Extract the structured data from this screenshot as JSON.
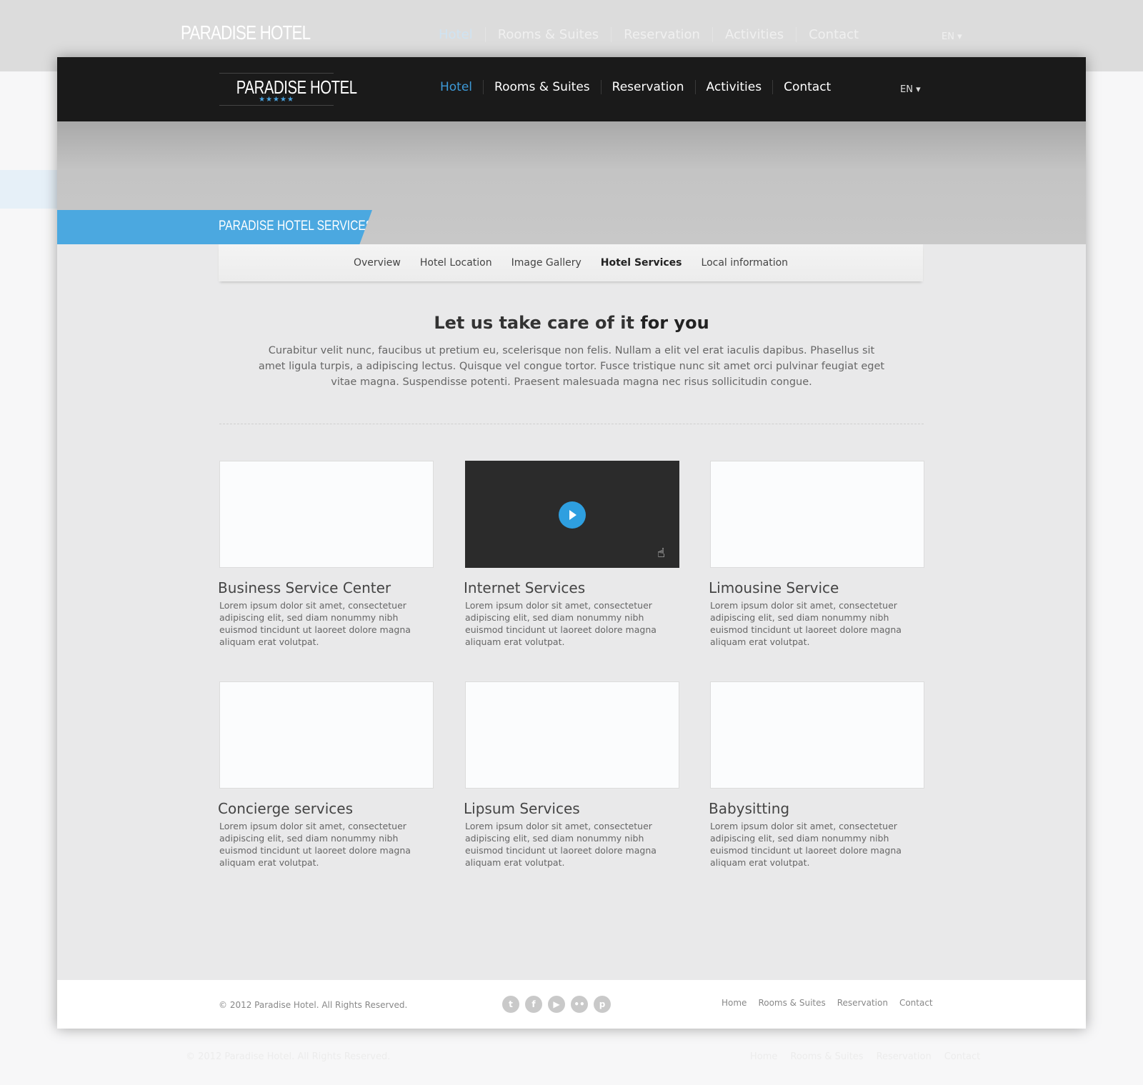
{
  "brand": {
    "name": "PARADISE HOTEL",
    "stars": "★★★★★"
  },
  "nav": {
    "items": [
      "Hotel",
      "Rooms & Suites",
      "Reservation",
      "Activities",
      "Contact"
    ],
    "active": "Hotel",
    "lang": "EN ▾"
  },
  "banner": {
    "title": "PARADISE HOTEL SERVICES"
  },
  "subnav": {
    "items": [
      "Overview",
      "Hotel Location",
      "Image Gallery",
      "Hotel Services",
      "Local information"
    ],
    "active": "Hotel Services"
  },
  "intro": {
    "title_plain": "Let us take care of it ",
    "title_bold": "for you",
    "text": "Curabitur velit nunc, faucibus ut pretium eu, scelerisque non felis. Nullam a elit vel erat iaculis dapibus. Phasellus sit amet ligula turpis, a adipiscing lectus. Quisque vel congue tortor. Fusce tristique nunc sit amet orci pulvinar feugiat eget vitae magna. Suspendisse potenti. Praesent malesuada magna nec risus sollicitudin congue."
  },
  "services": [
    {
      "title": "Business Service Center",
      "text": "Lorem ipsum dolor sit amet, consectetuer adipiscing elit, sed diam nonummy nibh euismod tincidunt ut laoreet dolore magna aliquam erat volutpat."
    },
    {
      "title": "Internet Services",
      "text": "Lorem ipsum dolor sit amet, consectetuer adipiscing elit, sed diam nonummy nibh euismod tincidunt ut laoreet dolore magna aliquam erat volutpat.",
      "video": true
    },
    {
      "title": "Limousine Service",
      "text": "Lorem ipsum dolor sit amet, consectetuer adipiscing elit, sed diam nonummy nibh euismod tincidunt ut laoreet dolore magna aliquam erat volutpat."
    },
    {
      "title": "Concierge services",
      "text": "Lorem ipsum dolor sit amet, consectetuer adipiscing elit, sed diam nonummy nibh euismod tincidunt ut laoreet dolore magna aliquam erat volutpat."
    },
    {
      "title": "Lipsum Services",
      "text": "Lorem ipsum dolor sit amet, consectetuer adipiscing elit, sed diam nonummy nibh euismod tincidunt ut laoreet dolore magna aliquam erat volutpat."
    },
    {
      "title": "Babysitting",
      "text": "Lorem ipsum dolor sit amet, consectetuer adipiscing elit, sed diam nonummy nibh euismod tincidunt ut laoreet dolore magna aliquam erat volutpat."
    }
  ],
  "footer": {
    "copyright": "© 2012 Paradise Hotel. All Rights Reserved.",
    "social": [
      {
        "name": "twitter-icon",
        "glyph": "t"
      },
      {
        "name": "facebook-icon",
        "glyph": "f"
      },
      {
        "name": "youtube-icon",
        "glyph": "▶"
      },
      {
        "name": "flickr-icon",
        "glyph": "••"
      },
      {
        "name": "pinterest-icon",
        "glyph": "p"
      }
    ],
    "links": [
      "Home",
      "Rooms & Suites",
      "Reservation",
      "Contact"
    ]
  },
  "colors": {
    "accent": "#4ba8e0",
    "header": "#1a1a1a"
  }
}
